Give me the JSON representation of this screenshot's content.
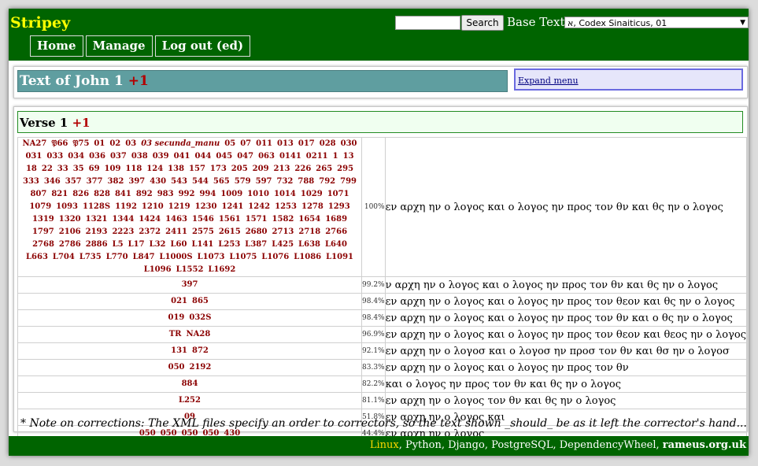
{
  "header": {
    "brand": "Stripey",
    "search_button": "Search",
    "search_value": "",
    "base_text_label": "Base Text:",
    "base_text_value": "א, Codex Sinaiticus, 01",
    "nav": [
      "Home",
      "Manage",
      "Log out (ed)"
    ]
  },
  "title_panel": {
    "title": "Text of John 1",
    "plus": "+1",
    "expand_menu": "Expand menu"
  },
  "verse": {
    "title": "Verse 1",
    "plus": "+1",
    "rows": [
      {
        "witnesses": [
          "NA27",
          "𝔓66",
          "𝔓75",
          "01",
          "02",
          "03",
          "03 secunda_manu",
          "05",
          "07",
          "011",
          "013",
          "017",
          "028",
          "030",
          "031",
          "033",
          "034",
          "036",
          "037",
          "038",
          "039",
          "041",
          "044",
          "045",
          "047",
          "063",
          "0141",
          "0211",
          "1",
          "13",
          "18",
          "22",
          "33",
          "35",
          "69",
          "109",
          "118",
          "124",
          "138",
          "157",
          "173",
          "205",
          "209",
          "213",
          "226",
          "265",
          "295",
          "333",
          "346",
          "357",
          "377",
          "382",
          "397",
          "430",
          "543",
          "544",
          "565",
          "579",
          "597",
          "732",
          "788",
          "792",
          "799",
          "807",
          "821",
          "826",
          "828",
          "841",
          "892",
          "983",
          "992",
          "994",
          "1009",
          "1010",
          "1014",
          "1029",
          "1071",
          "1079",
          "1093",
          "1128S",
          "1192",
          "1210",
          "1219",
          "1230",
          "1241",
          "1242",
          "1253",
          "1278",
          "1293",
          "1319",
          "1320",
          "1321",
          "1344",
          "1424",
          "1463",
          "1546",
          "1561",
          "1571",
          "1582",
          "1654",
          "1689",
          "1797",
          "2106",
          "2193",
          "2223",
          "2372",
          "2411",
          "2575",
          "2615",
          "2680",
          "2713",
          "2718",
          "2766",
          "2768",
          "2786",
          "2886",
          "L5",
          "L17",
          "L32",
          "L60",
          "L141",
          "L253",
          "L387",
          "L425",
          "L638",
          "L640",
          "L663",
          "L704",
          "L735",
          "L770",
          "L847",
          "L1000S",
          "L1073",
          "L1075",
          "L1076",
          "L1086",
          "L1091",
          "L1096",
          "L1552",
          "L1692"
        ],
        "pct": "100%",
        "text": "εν αρχη ην ο λογος και ο λογος ην προς τον θν και θς ην ο λογος"
      },
      {
        "witnesses": [
          "397"
        ],
        "pct": "99.2%",
        "text": "ν αρχη ην ο λογος και ο λογος ην προς τον θν και θς ην ο λογος"
      },
      {
        "witnesses": [
          "021",
          "865"
        ],
        "pct": "98.4%",
        "text": "εν αρχη ην ο λογος και ο λογος ην προς τον θεον και θς ην ο λογος"
      },
      {
        "witnesses": [
          "019",
          "032S"
        ],
        "pct": "98.4%",
        "text": "εν αρχη ην ο λογος και ο λογος ην προς τον θν και ο θς ην ο λογος"
      },
      {
        "witnesses": [
          "TR",
          "NA28"
        ],
        "pct": "96.9%",
        "text": "εν αρχη ην ο λογος και ο λογος ην προς τον θεον και θεος ην ο λογος"
      },
      {
        "witnesses": [
          "131",
          "872"
        ],
        "pct": "92.1%",
        "text": "εν αρχη ην ο λογοσ και ο λογοσ ην προσ τον θν και θσ ην ο λογοσ"
      },
      {
        "witnesses": [
          "050",
          "2192"
        ],
        "pct": "83.3%",
        "text": "εν αρχη ην ο λογος και ο λογος ην προς τον θν"
      },
      {
        "witnesses": [
          "884"
        ],
        "pct": "82.2%",
        "text": "και ο λογος ην προς τον θν και θς ην ο λογος"
      },
      {
        "witnesses": [
          "L252"
        ],
        "pct": "81.1%",
        "text": "εν αρχη ην ο λογος τον θν και θς ην ο λογος"
      },
      {
        "witnesses": [
          "09"
        ],
        "pct": "51.8%",
        "text": "εν αρχη ην ο λογος και"
      },
      {
        "witnesses": [
          "050",
          "050",
          "050",
          "050",
          "430"
        ],
        "pct": "44.4%",
        "text": "εν αρχη ην ο λογος"
      }
    ]
  },
  "footnote": "* Note on corrections: The XML files specify an order to correctors, so the text shown _should_ be as it left the corrector's hand...",
  "footer": {
    "linux": "Linux",
    "techs": ", Python, Django, PostgreSQL, DependencyWheel, ",
    "site": "rameus.org.uk"
  },
  "colors": {
    "header_green": "#006400",
    "brand_yellow": "#ffff00",
    "title_bar_teal": "#5f9ea0",
    "witness_red": "#8b0000",
    "plus_red": "#b30000"
  }
}
